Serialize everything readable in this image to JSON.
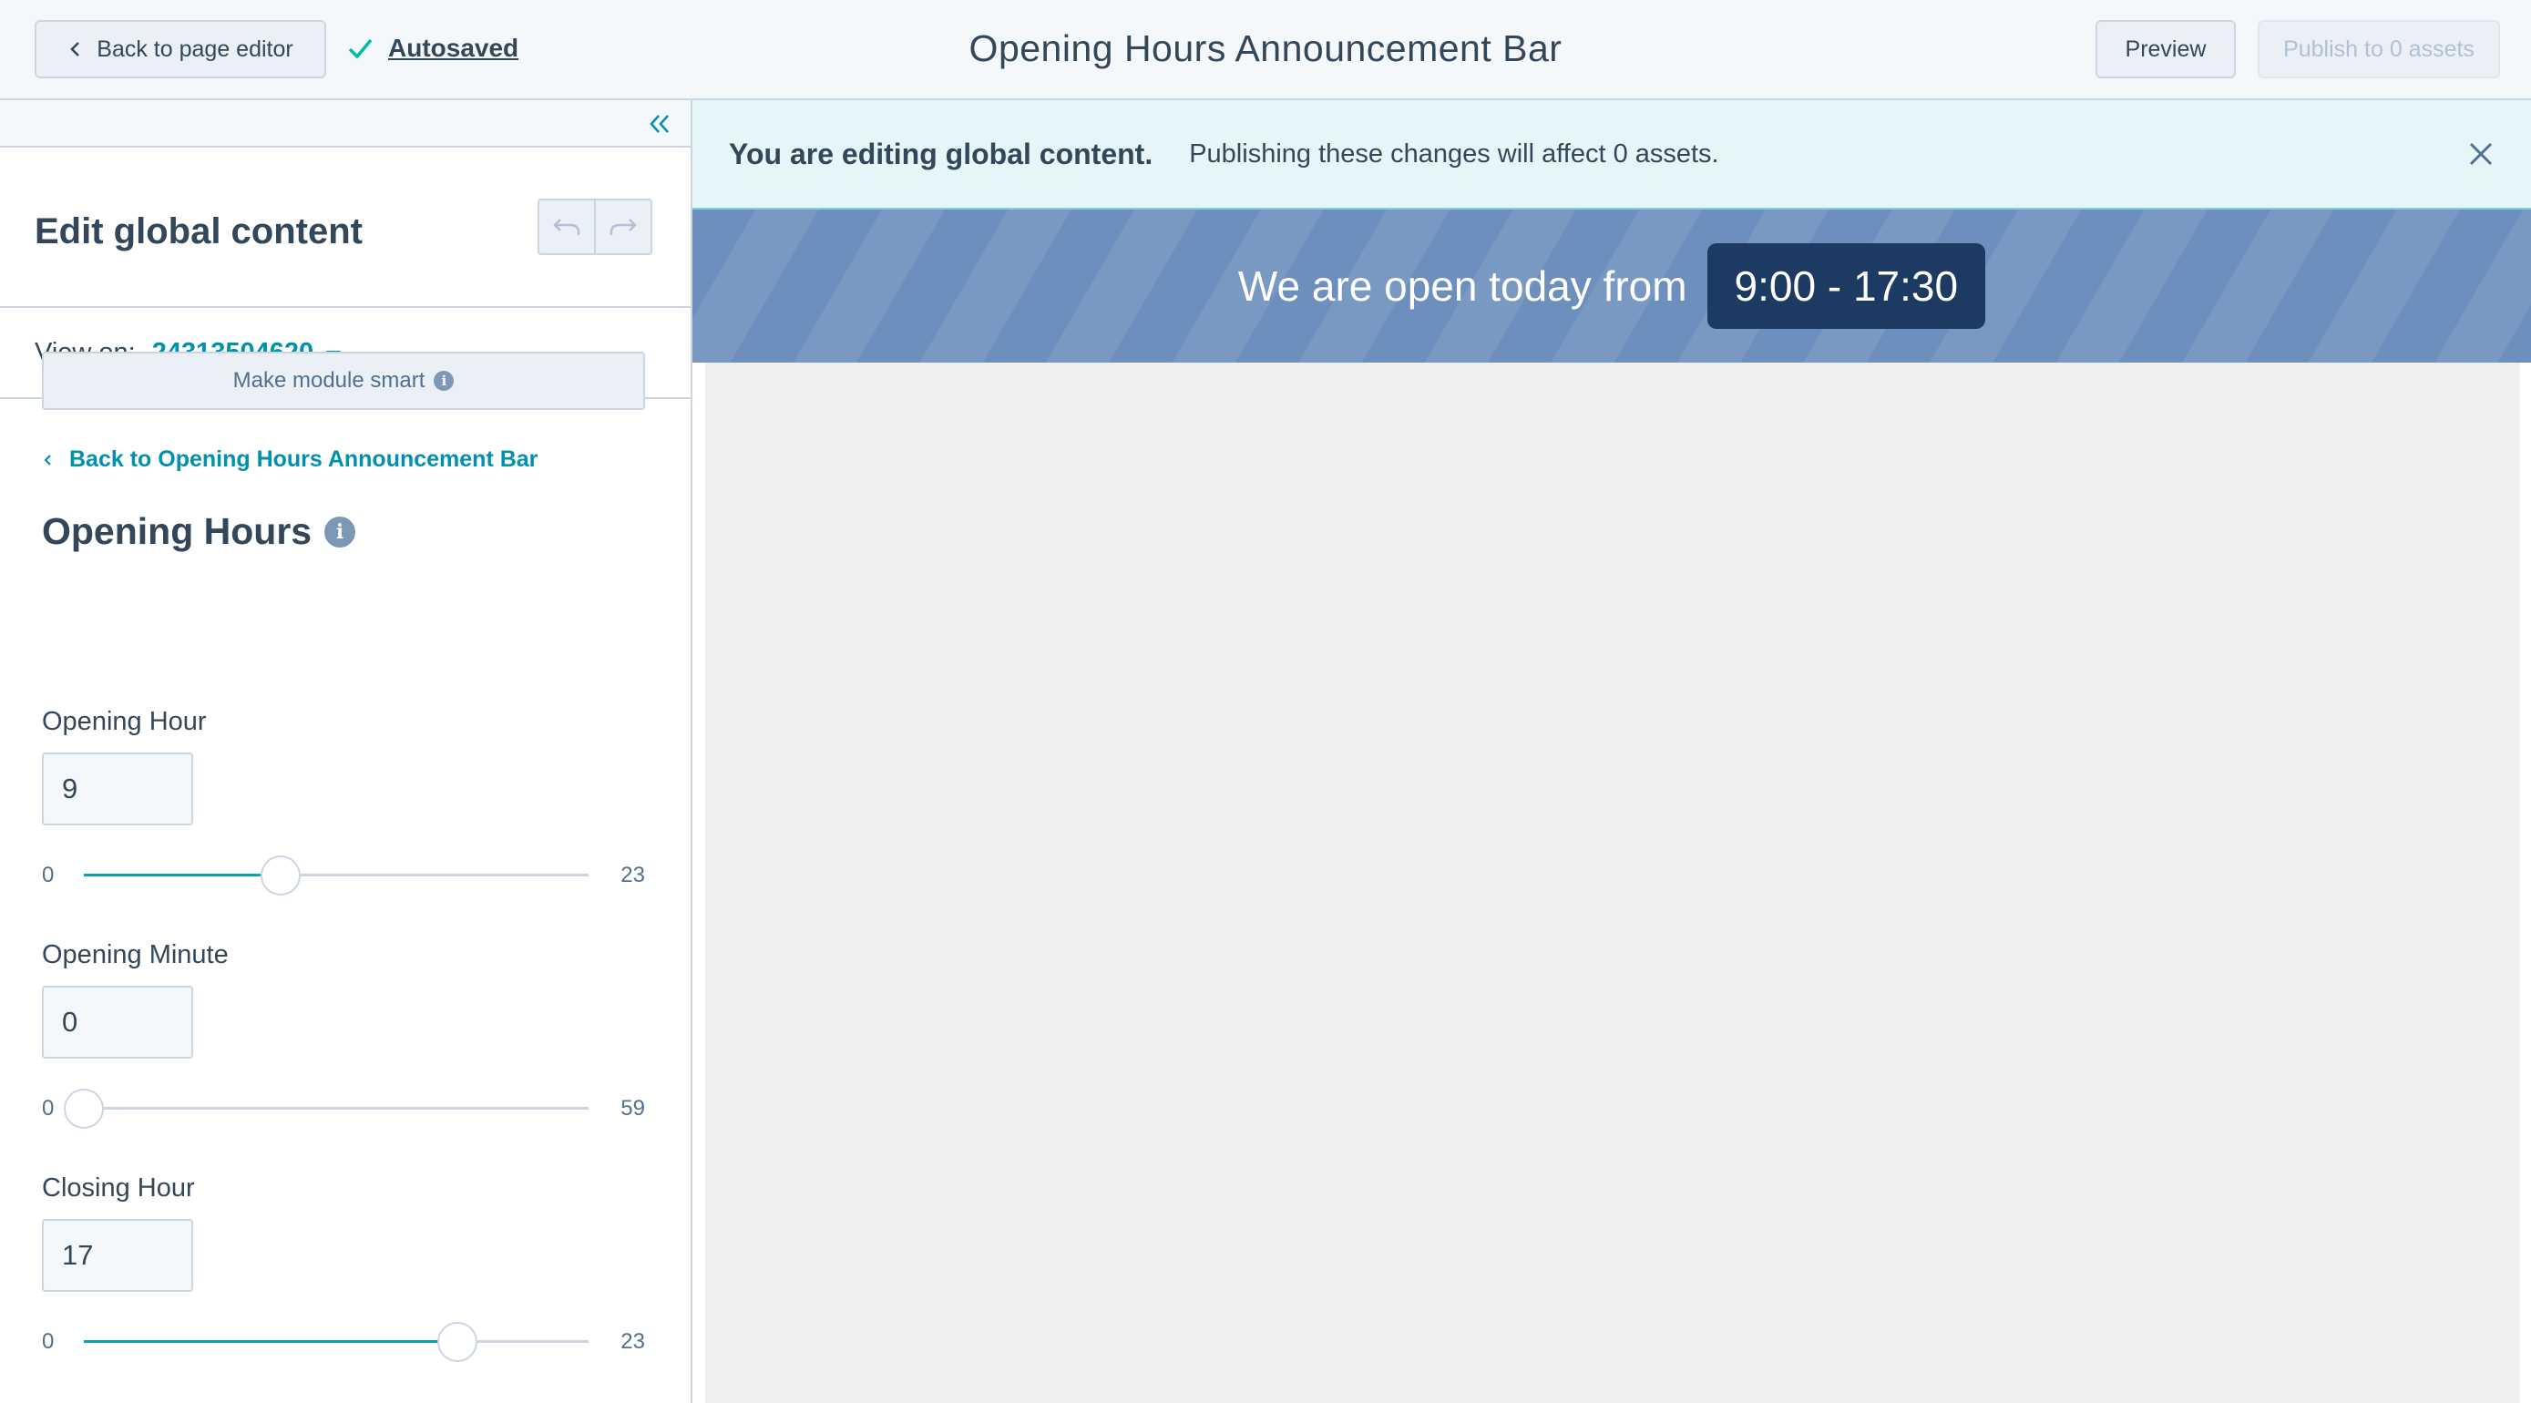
{
  "topbar": {
    "back_label": "Back to page editor",
    "autosaved_label": "Autosaved",
    "title": "Opening Hours Announcement Bar",
    "preview_label": "Preview",
    "publish_label": "Publish to 0 assets"
  },
  "sidebar": {
    "title": "Edit global content",
    "view_on_label": "View on:",
    "view_on_value": "24313504620",
    "smart_button": "Make module smart",
    "back_link": "Back to Opening Hours Announcement Bar",
    "section_title": "Opening Hours",
    "fields": [
      {
        "label": "Opening Hour",
        "value": "9",
        "min": "0",
        "max": "23",
        "level": 0.39
      },
      {
        "label": "Opening Minute",
        "value": "0",
        "min": "0",
        "max": "59",
        "level": 0.0
      },
      {
        "label": "Closing Hour",
        "value": "17",
        "min": "0",
        "max": "23",
        "level": 0.74
      }
    ]
  },
  "main": {
    "banner_bold": "You are editing global content.",
    "banner_message": "Publishing these changes will affect 0 assets.",
    "announce_text": "We are open today from",
    "time_badge": "9:00 - 17:30"
  },
  "colors": {
    "accent": "#0091ae",
    "slider_fill": "#00a4bd",
    "announce_bg": "#6c8fbd",
    "badge_bg": "#1d3a63",
    "check": "#00bda5"
  },
  "icons": {
    "back": "chevron-left-icon",
    "autosaved": "check-icon",
    "collapse": "double-chevron-left-icon",
    "undo": "undo-icon",
    "redo": "redo-icon",
    "dropdown": "caret-down-icon",
    "info": "info-icon",
    "close": "close-icon"
  }
}
